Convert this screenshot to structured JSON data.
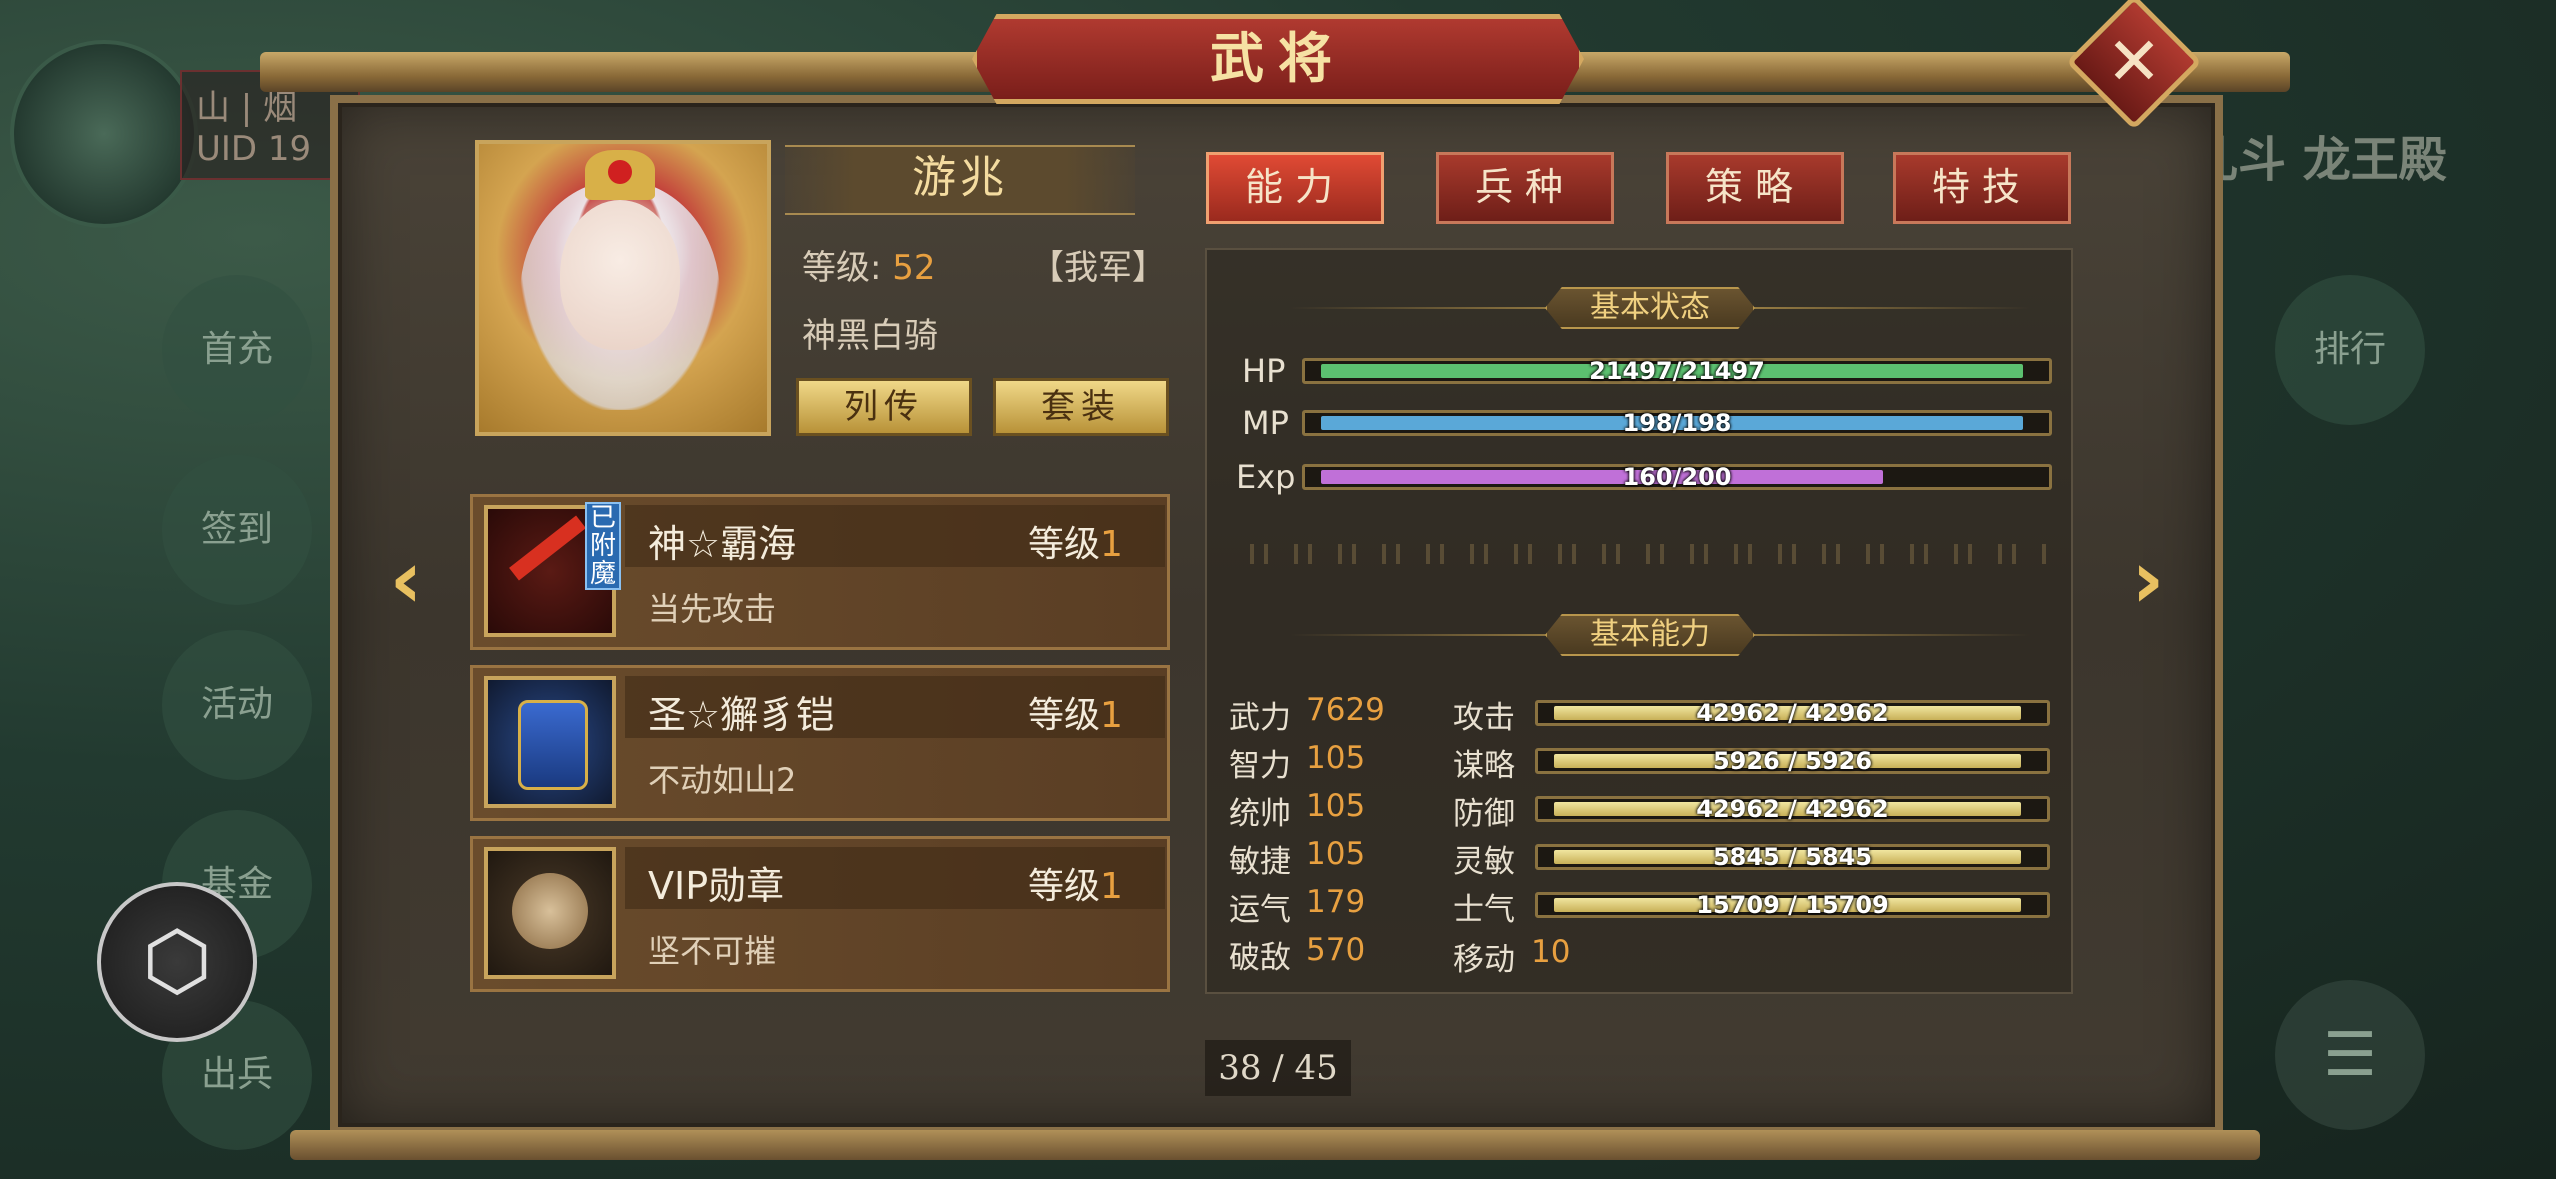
{
  "background": {
    "uid_label": "UID 19",
    "uid_prefix": "山 | 烟",
    "side_buttons": [
      "首充",
      "签到",
      "活动",
      "基金",
      "出兵"
    ],
    "right_title": "乱斗 龙王殿",
    "right_button": "排行"
  },
  "dialog": {
    "title": "武将",
    "close_icon": "close-x-icon"
  },
  "general": {
    "name": "游兆",
    "level_label": "等级:",
    "level_value": "52",
    "faction": "【我军】",
    "troop": "神黑白骑",
    "biography_button": "列传",
    "set_button": "套装"
  },
  "equipment": [
    {
      "name": "神☆霸海",
      "level_label": "等级",
      "level": "1",
      "desc": "当先攻击",
      "badge": "已附魔",
      "icon": "sword-icon"
    },
    {
      "name": "圣☆獬豸铠",
      "level_label": "等级",
      "level": "1",
      "desc": "不动如山2",
      "icon": "armor-icon"
    },
    {
      "name": "VIP勋章",
      "level_label": "等级",
      "level": "1",
      "desc": "坚不可摧",
      "icon": "medal-icon"
    }
  ],
  "tabs": [
    "能力",
    "兵种",
    "策略",
    "特技"
  ],
  "active_tab": 0,
  "status_section": {
    "title": "基本状态",
    "bars": [
      {
        "label": "HP",
        "text": "21497/21497",
        "fraction": 1.0,
        "color": "#5cc070"
      },
      {
        "label": "MP",
        "text": "198/198",
        "fraction": 1.0,
        "color": "#5aa8d8"
      },
      {
        "label": "Exp",
        "text": "160/200",
        "fraction": 0.8,
        "color": "#c070d8"
      }
    ]
  },
  "ability_section": {
    "title": "基本能力",
    "left_stats": [
      {
        "label": "武力",
        "value": "7629"
      },
      {
        "label": "智力",
        "value": "105"
      },
      {
        "label": "统帅",
        "value": "105"
      },
      {
        "label": "敏捷",
        "value": "105"
      },
      {
        "label": "运气",
        "value": "179"
      },
      {
        "label": "破敌",
        "value": "570"
      }
    ],
    "right_stats": [
      {
        "label": "攻击",
        "text": "42962 / 42962",
        "fraction": 1.0
      },
      {
        "label": "谋略",
        "text": "5926 / 5926",
        "fraction": 1.0
      },
      {
        "label": "防御",
        "text": "42962 / 42962",
        "fraction": 1.0
      },
      {
        "label": "灵敏",
        "text": "5845 / 5845",
        "fraction": 1.0
      },
      {
        "label": "士气",
        "text": "15709 / 15709",
        "fraction": 1.0
      }
    ],
    "move": {
      "label": "移动",
      "value": "10"
    }
  },
  "pagination": {
    "text": "38 / 45"
  },
  "nav": {
    "prev_icon": "arrow-left-icon",
    "next_icon": "arrow-right-icon"
  }
}
